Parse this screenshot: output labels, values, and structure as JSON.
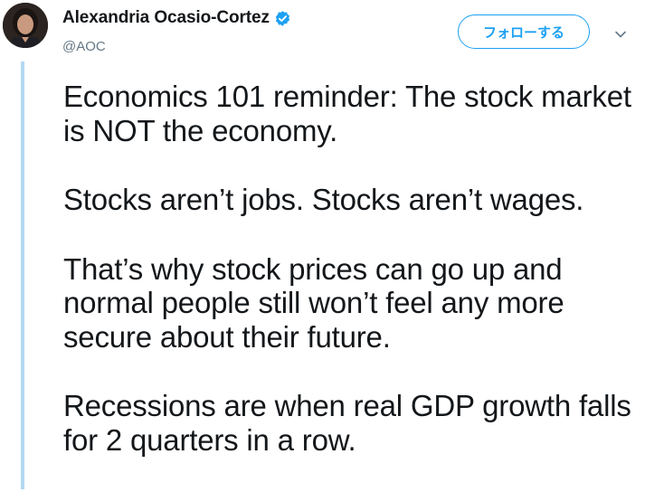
{
  "user": {
    "display_name": "Alexandria Ocasio-Cortez",
    "handle": "@AOC",
    "verified": true,
    "avatar_icon": "profile-photo"
  },
  "actions": {
    "follow_label": "フォローする",
    "more_icon": "chevron-down-icon"
  },
  "tweet": {
    "paragraphs": [
      "Economics 101 reminder: The stock market is NOT the economy.",
      "Stocks aren’t jobs. Stocks aren’t wages.",
      "That’s why stock prices can go up and normal people still won’t feel any more secure about their future.",
      "Recessions are when real GDP growth falls for 2 quarters in a row."
    ]
  },
  "colors": {
    "accent": "#1da1f2",
    "thread_line": "#b3d9f2",
    "text": "#14171a",
    "secondary_text": "#657786"
  }
}
